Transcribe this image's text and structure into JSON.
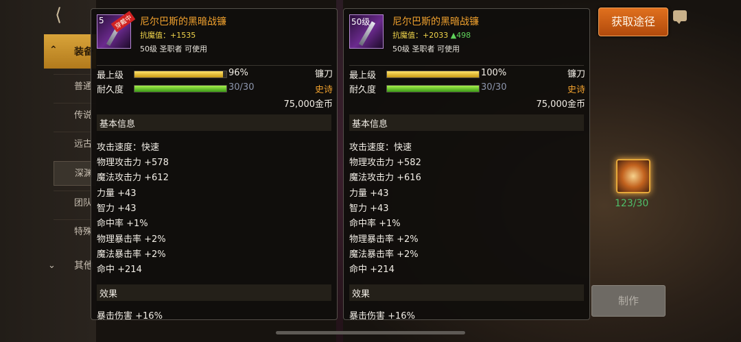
{
  "left_card": {
    "level_tag": "5",
    "badge": "穿戴中",
    "name": "尼尔巴斯的黑暗战镰",
    "resist_label": "抗魔值：",
    "resist_value": "+1535",
    "requirement": "50级 圣职者 可使用",
    "grade_label": "最上级",
    "grade_pct": "96%",
    "grade_fraction": 0.96,
    "weapon_type": "镰刀",
    "durability_label": "耐久度",
    "durability": "30/30",
    "durability_fraction": 1.0,
    "rarity": "史诗",
    "price": "75,000金币",
    "section_basic": "基本信息",
    "stats": [
      "攻击速度：快速",
      "物理攻击力 +578",
      "魔法攻击力 +612",
      "力量 +43",
      "智力 +43",
      "命中率 +1%",
      "物理暴击率 +2%",
      "魔法暴击率 +2%",
      "命中 +214"
    ],
    "section_effect": "效果",
    "effect_partial": "暴击伤害 +16%"
  },
  "right_card": {
    "level_tag": "50级",
    "name": "尼尔巴斯的黑暗战镰",
    "resist_label": "抗魔值：",
    "resist_value": "+2033",
    "resist_delta": "▲498",
    "requirement": "50级 圣职者 可使用",
    "grade_label": "最上级",
    "grade_pct": "100%",
    "grade_fraction": 1.0,
    "weapon_type": "镰刀",
    "durability_label": "耐久度",
    "durability": "30/30",
    "durability_fraction": 1.0,
    "rarity": "史诗",
    "price": "75,000金币",
    "section_basic": "基本信息",
    "stats": [
      "攻击速度：快速",
      "物理攻击力 +582",
      "魔法攻击力 +616",
      "力量 +43",
      "智力 +43",
      "命中率 +1%",
      "物理暴击率 +2%",
      "魔法暴击率 +2%",
      "命中 +214"
    ],
    "section_effect": "效果",
    "effect_partial": "暴击伤害 +16%"
  },
  "sidebar": {
    "header_label": "装备",
    "items": [
      "普通",
      "传说",
      "远古",
      "深渊",
      "团队",
      "特殊"
    ],
    "other_label": "其他"
  },
  "acquire_button": "获取途径",
  "reward_count": "123/30",
  "make_button": "制作",
  "colors": {
    "accent_orange": "#e0701e",
    "epic_gold": "#f2a22e",
    "stat_up_green": "#5fd35a"
  }
}
